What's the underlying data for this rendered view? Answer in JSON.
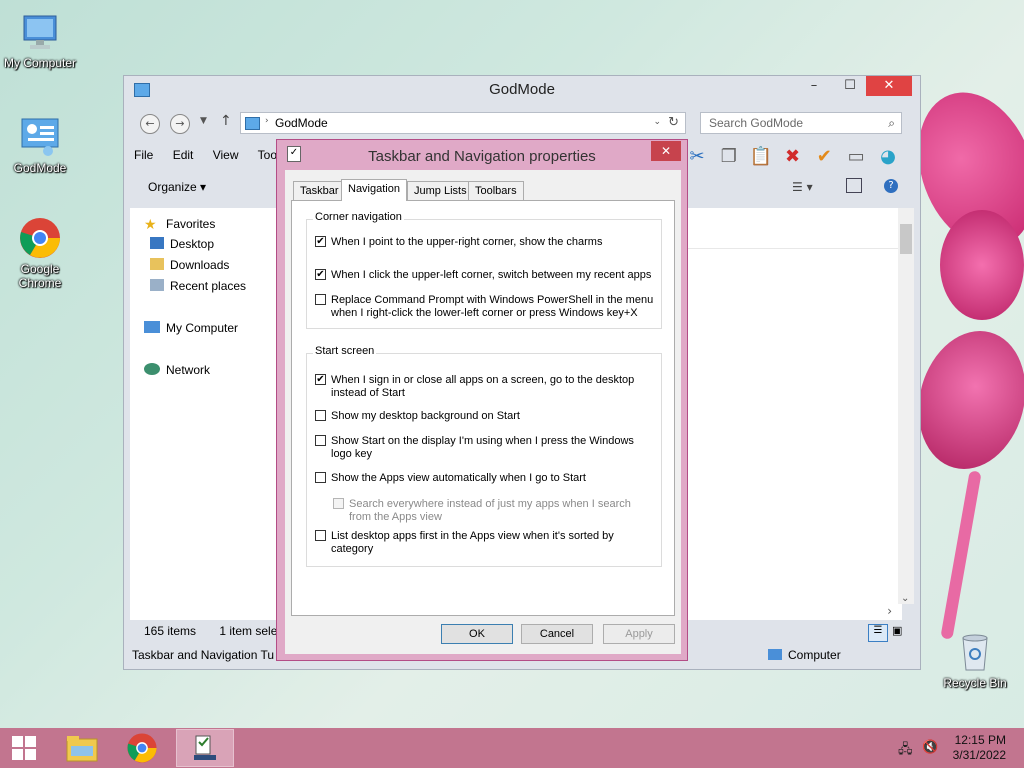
{
  "desktop": {
    "icons": [
      {
        "label": "My Computer"
      },
      {
        "label": "GodMode"
      },
      {
        "label": "Google Chrome"
      },
      {
        "label": "Recycle Bin"
      }
    ]
  },
  "explorer": {
    "title": "GodMode",
    "address": "GodMode",
    "search_placeholder": "Search GodMode",
    "menu": [
      "File",
      "Edit",
      "View",
      "Tools"
    ],
    "organize_label": "Organize",
    "nav": {
      "favorites": "Favorites",
      "desktop": "Desktop",
      "downloads": "Downloads",
      "recent_places": "Recent places",
      "my_computer": "My Computer",
      "network": "Network"
    },
    "status": {
      "item_count": "165 items",
      "selected": "1 item selec",
      "selected_name": "Taskbar and Navigation Tu",
      "location": "Computer"
    }
  },
  "dialog": {
    "title": "Taskbar and Navigation properties",
    "close_label": "✕",
    "tabs": [
      "Taskbar",
      "Navigation",
      "Jump Lists",
      "Toolbars"
    ],
    "active_tab": "Navigation",
    "corner_group": {
      "label": "Corner navigation",
      "options": [
        {
          "text": "When I point to the upper-right corner, show the charms",
          "checked": true
        },
        {
          "text": "When I click the upper-left corner, switch between my recent apps",
          "checked": true
        },
        {
          "text": "Replace Command Prompt with Windows PowerShell in the menu when I right-click the lower-left corner or press Windows key+X",
          "checked": false
        }
      ]
    },
    "start_group": {
      "label": "Start screen",
      "options": [
        {
          "text": "When I sign in or close all apps on a screen, go to the desktop instead of Start",
          "checked": true
        },
        {
          "text": "Show my desktop background on Start",
          "checked": false
        },
        {
          "text": "Show Start on the display I'm using when I press the Windows logo key",
          "checked": false
        },
        {
          "text": "Show the Apps view automatically when I go to Start",
          "checked": false
        },
        {
          "text": "Search everywhere instead of just my apps when I search from the Apps view",
          "checked": false,
          "disabled": true
        },
        {
          "text": "List desktop apps first in the Apps view when it's sorted by category",
          "checked": false
        }
      ]
    },
    "buttons": {
      "ok": "OK",
      "cancel": "Cancel",
      "apply": "Apply"
    }
  },
  "taskbar": {
    "time": "12:15 PM",
    "date": "3/31/2022"
  }
}
